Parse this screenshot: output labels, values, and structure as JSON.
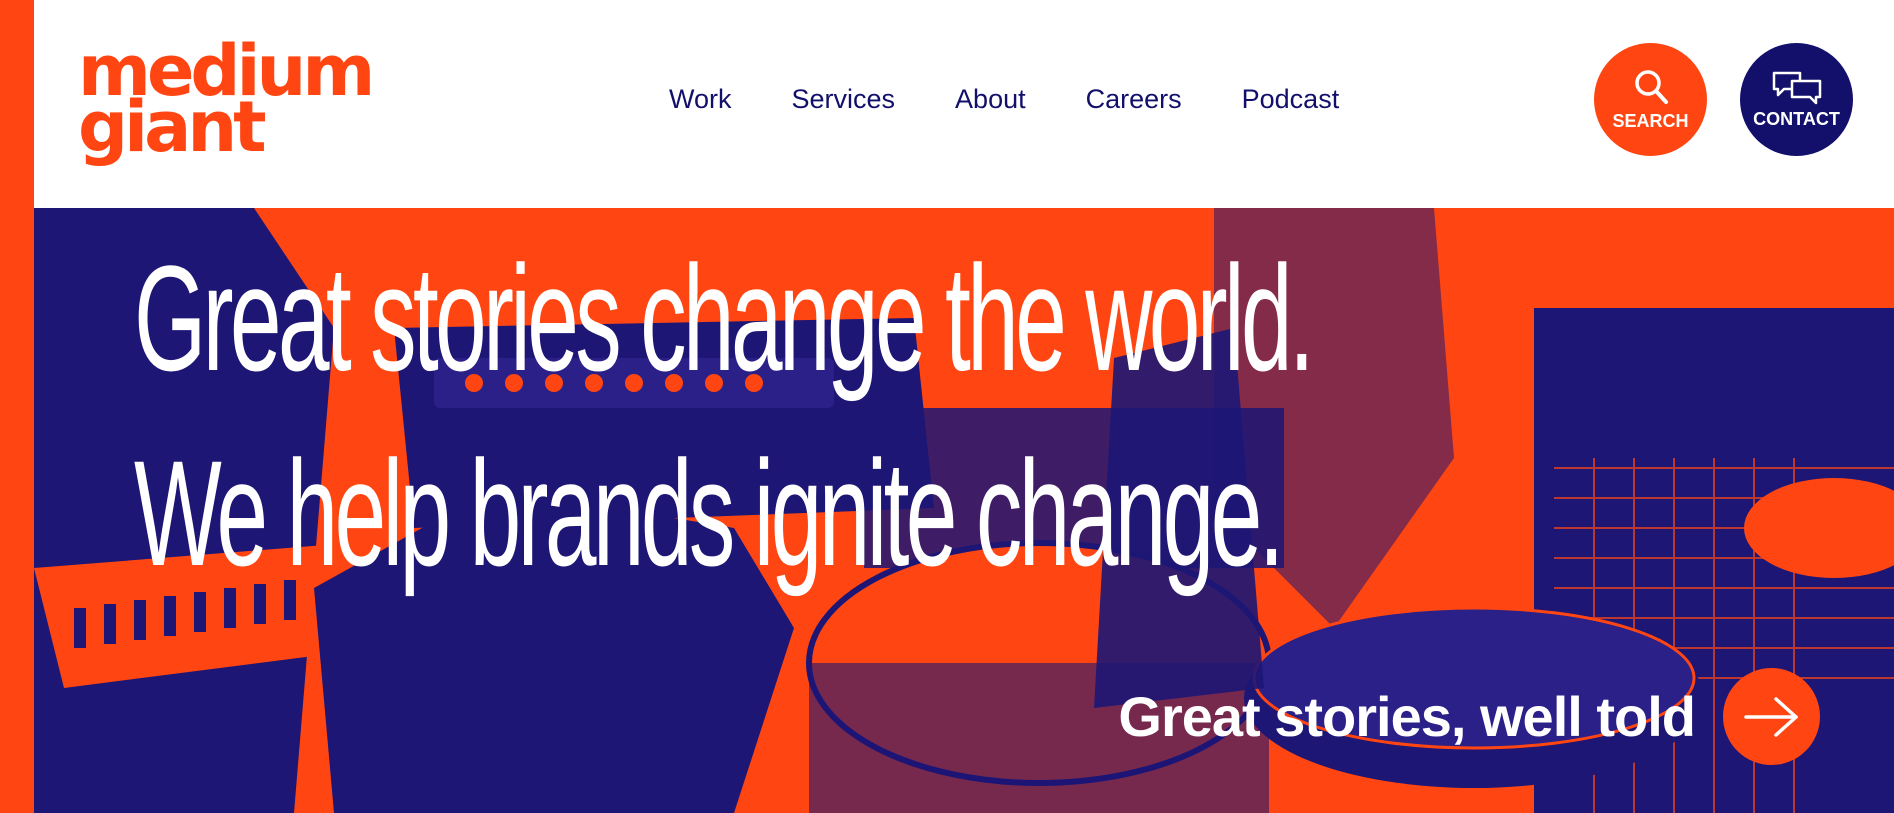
{
  "brand": {
    "logo_line1": "medium",
    "logo_line2": "giant",
    "accent_color": "#ff4612",
    "navy_color": "#12106b"
  },
  "nav": {
    "items": [
      {
        "label": "Work"
      },
      {
        "label": "Services"
      },
      {
        "label": "About"
      },
      {
        "label": "Careers"
      },
      {
        "label": "Podcast"
      }
    ]
  },
  "actions": {
    "search_label": "SEARCH",
    "search_icon": "search-icon",
    "contact_label": "CONTACT",
    "contact_icon": "chat-bubbles-icon"
  },
  "hero": {
    "headline_line1": "Great stories change the world.",
    "headline_line2": "We help brands ignite change.",
    "cta_text": "Great stories, well told",
    "cta_icon": "arrow-right-icon"
  }
}
